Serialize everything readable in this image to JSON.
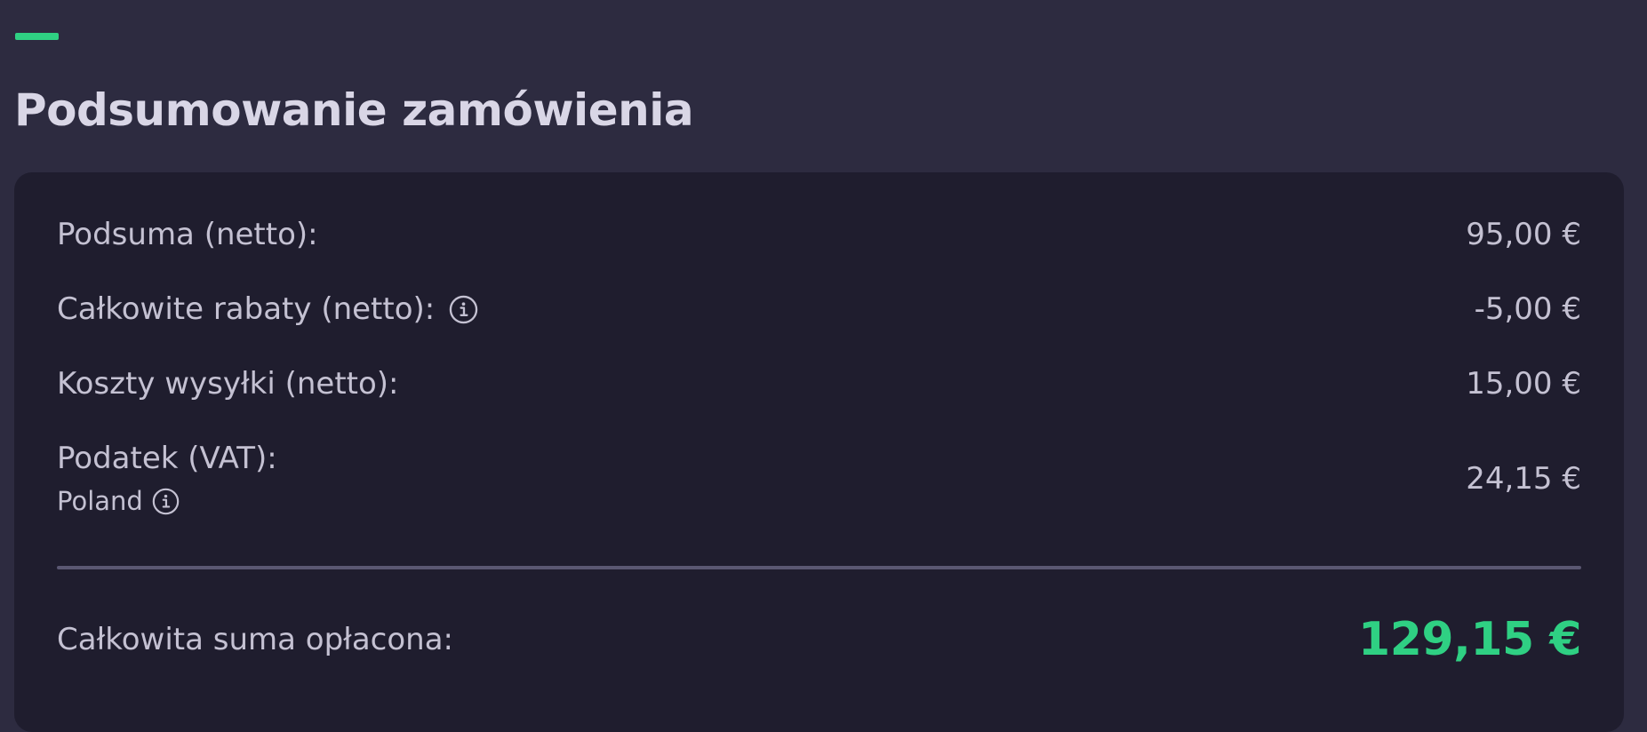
{
  "header": {
    "title": "Podsumowanie zamówienia"
  },
  "summary": {
    "subtotal": {
      "label": "Podsuma (netto):",
      "value": "95,00 €"
    },
    "discounts": {
      "label": "Całkowite rabaty (netto):",
      "value": "-5,00 €",
      "icon": "info-icon"
    },
    "shipping": {
      "label": "Koszty wysyłki (netto):",
      "value": "15,00 €"
    },
    "tax": {
      "label": "Podatek (VAT):",
      "country": "Poland",
      "value": "24,15 €",
      "icon": "info-icon"
    },
    "total": {
      "label": "Całkowita suma opłacona:",
      "value": "129,15 €"
    }
  },
  "colors": {
    "accent": "#2fd083",
    "background": "#2d2b40",
    "card": "#1f1d2e",
    "divider": "#5a5772"
  }
}
